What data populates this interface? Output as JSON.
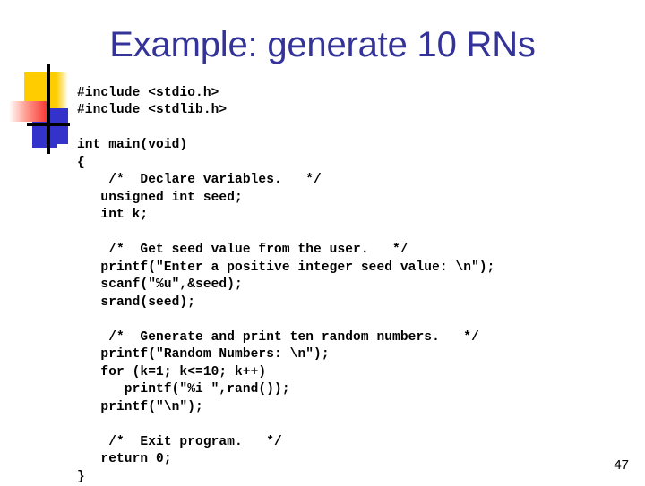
{
  "slide": {
    "title": "Example: generate 10 RNs",
    "page_number": "47",
    "title_color": "#333399",
    "background_color": "#ffffff",
    "code_color": "#000000"
  },
  "decoration": {
    "name": "powerpoint-corner-motif",
    "yellow": "#ffcc00",
    "blue": "#3333cc",
    "red": "#f62727",
    "line": "#000000"
  },
  "code": {
    "language": "c",
    "lines": [
      "#include <stdio.h>",
      "#include <stdlib.h>",
      "",
      "int main(void)",
      "{",
      "    /*  Declare variables.   */",
      "   unsigned int seed;",
      "   int k;",
      "",
      "    /*  Get seed value from the user.   */",
      "   printf(\"Enter a positive integer seed value: \\n\");",
      "   scanf(\"%u\",&seed);",
      "   srand(seed);",
      "",
      "    /*  Generate and print ten random numbers.   */",
      "   printf(\"Random Numbers: \\n\");",
      "   for (k=1; k<=10; k++)",
      "      printf(\"%i \",rand());",
      "   printf(\"\\n\");",
      "",
      "    /*  Exit program.   */",
      "   return 0;",
      "}"
    ],
    "full_text": "#include <stdio.h>\n#include <stdlib.h>\n\nint main(void)\n{\n    /*  Declare variables.   */\n   unsigned int seed;\n   int k;\n\n    /*  Get seed value from the user.   */\n   printf(\"Enter a positive integer seed value: \\n\");\n   scanf(\"%u\",&seed);\n   srand(seed);\n\n    /*  Generate and print ten random numbers.   */\n   printf(\"Random Numbers: \\n\");\n   for (k=1; k<=10; k++)\n      printf(\"%i \",rand());\n   printf(\"\\n\");\n\n    /*  Exit program.   */\n   return 0;\n}"
  }
}
